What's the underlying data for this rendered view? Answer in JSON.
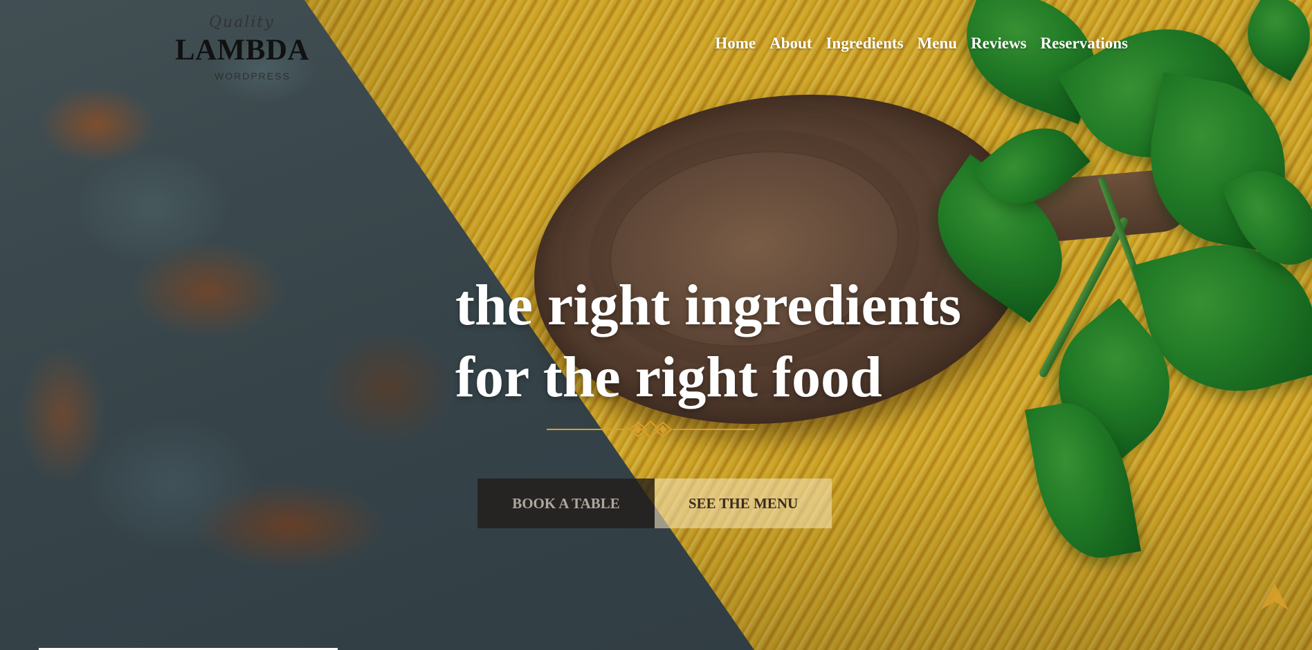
{
  "logo": {
    "script_text": "Quality",
    "name": "LAMBDA",
    "subtitle": "WORDPRESS"
  },
  "nav": {
    "items": [
      {
        "label": "Home"
      },
      {
        "label": "About"
      },
      {
        "label": "Ingredients"
      },
      {
        "label": "Menu"
      },
      {
        "label": "Reviews"
      },
      {
        "label": "Reservations"
      }
    ]
  },
  "hero": {
    "headline_line1": "the right ingredients",
    "headline_line2": "for the right food",
    "book_button": "BOOK A TABLE",
    "menu_button": "SEE THE MENU"
  },
  "icons": {
    "divider": "ornament-divider-icon",
    "to_top": "chevron-up-icon"
  },
  "colors": {
    "accent_gold": "#d8a02a",
    "text_white": "#ffffff",
    "book_button_bg": "#231c18",
    "menu_button_bg": "#f5e6be"
  }
}
